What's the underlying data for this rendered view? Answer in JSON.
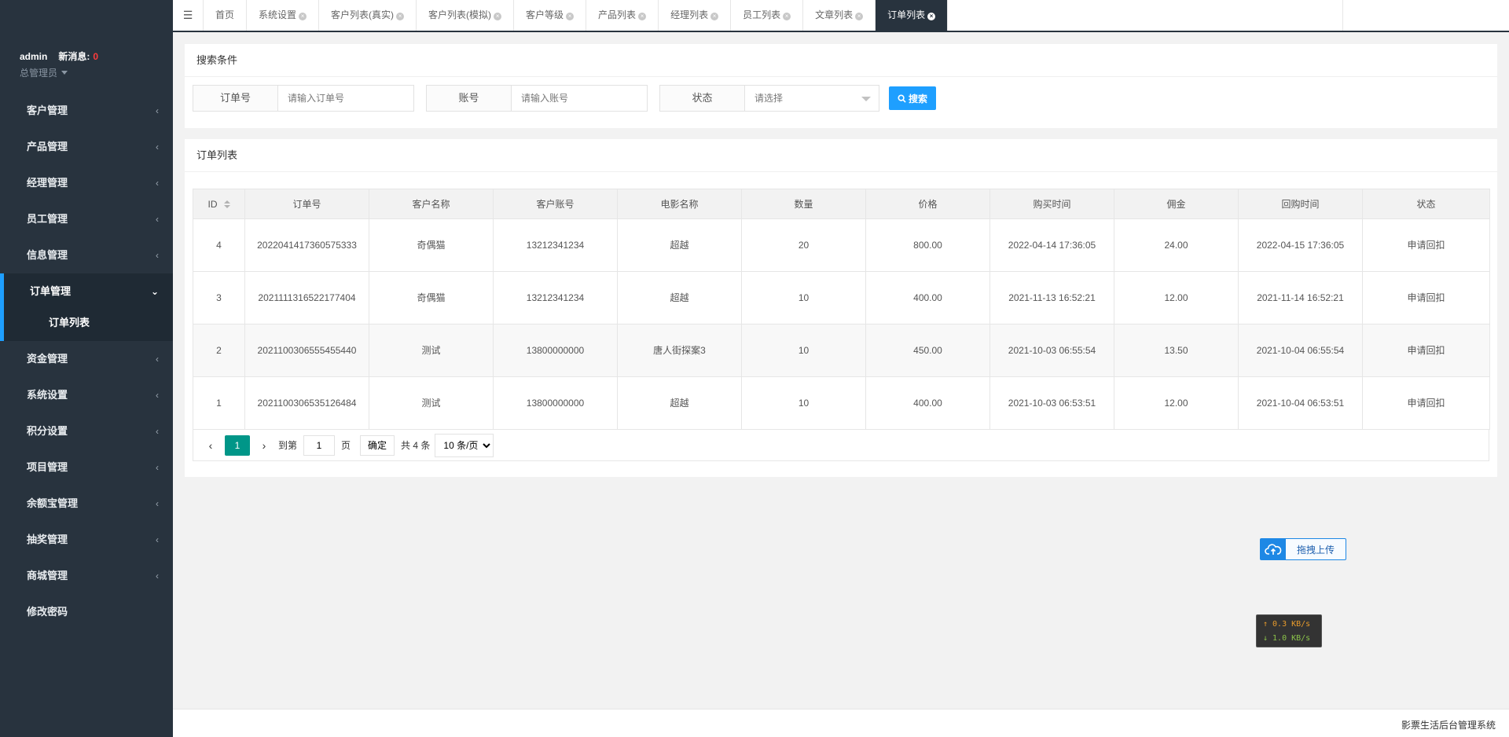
{
  "sidebar": {
    "user": {
      "name": "admin",
      "msg_label": "新消息:",
      "msg_count": "0",
      "role": "总管理员"
    },
    "menu": [
      {
        "label": "客户管理"
      },
      {
        "label": "产品管理"
      },
      {
        "label": "经理管理"
      },
      {
        "label": "员工管理"
      },
      {
        "label": "信息管理"
      },
      {
        "label": "订单管理",
        "open": true,
        "children": [
          {
            "label": "订单列表"
          }
        ]
      },
      {
        "label": "资金管理"
      },
      {
        "label": "系统设置"
      },
      {
        "label": "积分设置"
      },
      {
        "label": "项目管理"
      },
      {
        "label": "余额宝管理"
      },
      {
        "label": "抽奖管理"
      },
      {
        "label": "商城管理"
      },
      {
        "label": "修改密码"
      }
    ]
  },
  "tabs": [
    {
      "label": "首页"
    },
    {
      "label": "系统设置"
    },
    {
      "label": "客户列表(真实)"
    },
    {
      "label": "客户列表(模拟)"
    },
    {
      "label": "客户等级"
    },
    {
      "label": "产品列表"
    },
    {
      "label": "经理列表"
    },
    {
      "label": "员工列表"
    },
    {
      "label": "文章列表"
    },
    {
      "label": "订单列表",
      "active": true
    }
  ],
  "search": {
    "title": "搜索条件",
    "order_label": "订单号",
    "order_placeholder": "请输入订单号",
    "account_label": "账号",
    "account_placeholder": "请输入账号",
    "status_label": "状态",
    "status_value": "请选择",
    "button": "搜索"
  },
  "list": {
    "title": "订单列表",
    "columns": [
      "ID",
      "订单号",
      "客户名称",
      "客户账号",
      "电影名称",
      "数量",
      "价格",
      "购买时间",
      "佣金",
      "回购时间",
      "状态"
    ],
    "rows": [
      [
        "4",
        "2022041417360575333",
        "奇偶猫",
        "13212341234",
        "超越",
        "20",
        "800.00",
        "2022-04-14 17:36:05",
        "24.00",
        "2022-04-15 17:36:05",
        "申请回扣"
      ],
      [
        "3",
        "2021111316522177404",
        "奇偶猫",
        "13212341234",
        "超越",
        "10",
        "400.00",
        "2021-11-13 16:52:21",
        "12.00",
        "2021-11-14 16:52:21",
        "申请回扣"
      ],
      [
        "2",
        "2021100306555455440",
        "测试",
        "13800000000",
        "唐人街探案3",
        "10",
        "450.00",
        "2021-10-03 06:55:54",
        "13.50",
        "2021-10-04 06:55:54",
        "申请回扣"
      ],
      [
        "1",
        "2021100306535126484",
        "测试",
        "13800000000",
        "超越",
        "10",
        "400.00",
        "2021-10-03 06:53:51",
        "12.00",
        "2021-10-04 06:53:51",
        "申请回扣"
      ]
    ]
  },
  "pager": {
    "current": "1",
    "goto_label": "到第",
    "goto_value": "1",
    "page_unit": "页",
    "confirm": "确定",
    "total": "共 4 条",
    "page_size": "10 条/页"
  },
  "upload": {
    "label": "拖拽上传"
  },
  "speed": {
    "up": "↑ 0.3 KB/s",
    "down": "↓ 1.0 KB/s"
  },
  "footer": {
    "text": "影票生活后台管理系统"
  },
  "colors": {
    "sidebar_bg": "#28333e",
    "accent_blue": "#1e9fff",
    "pager_active": "#009688"
  }
}
